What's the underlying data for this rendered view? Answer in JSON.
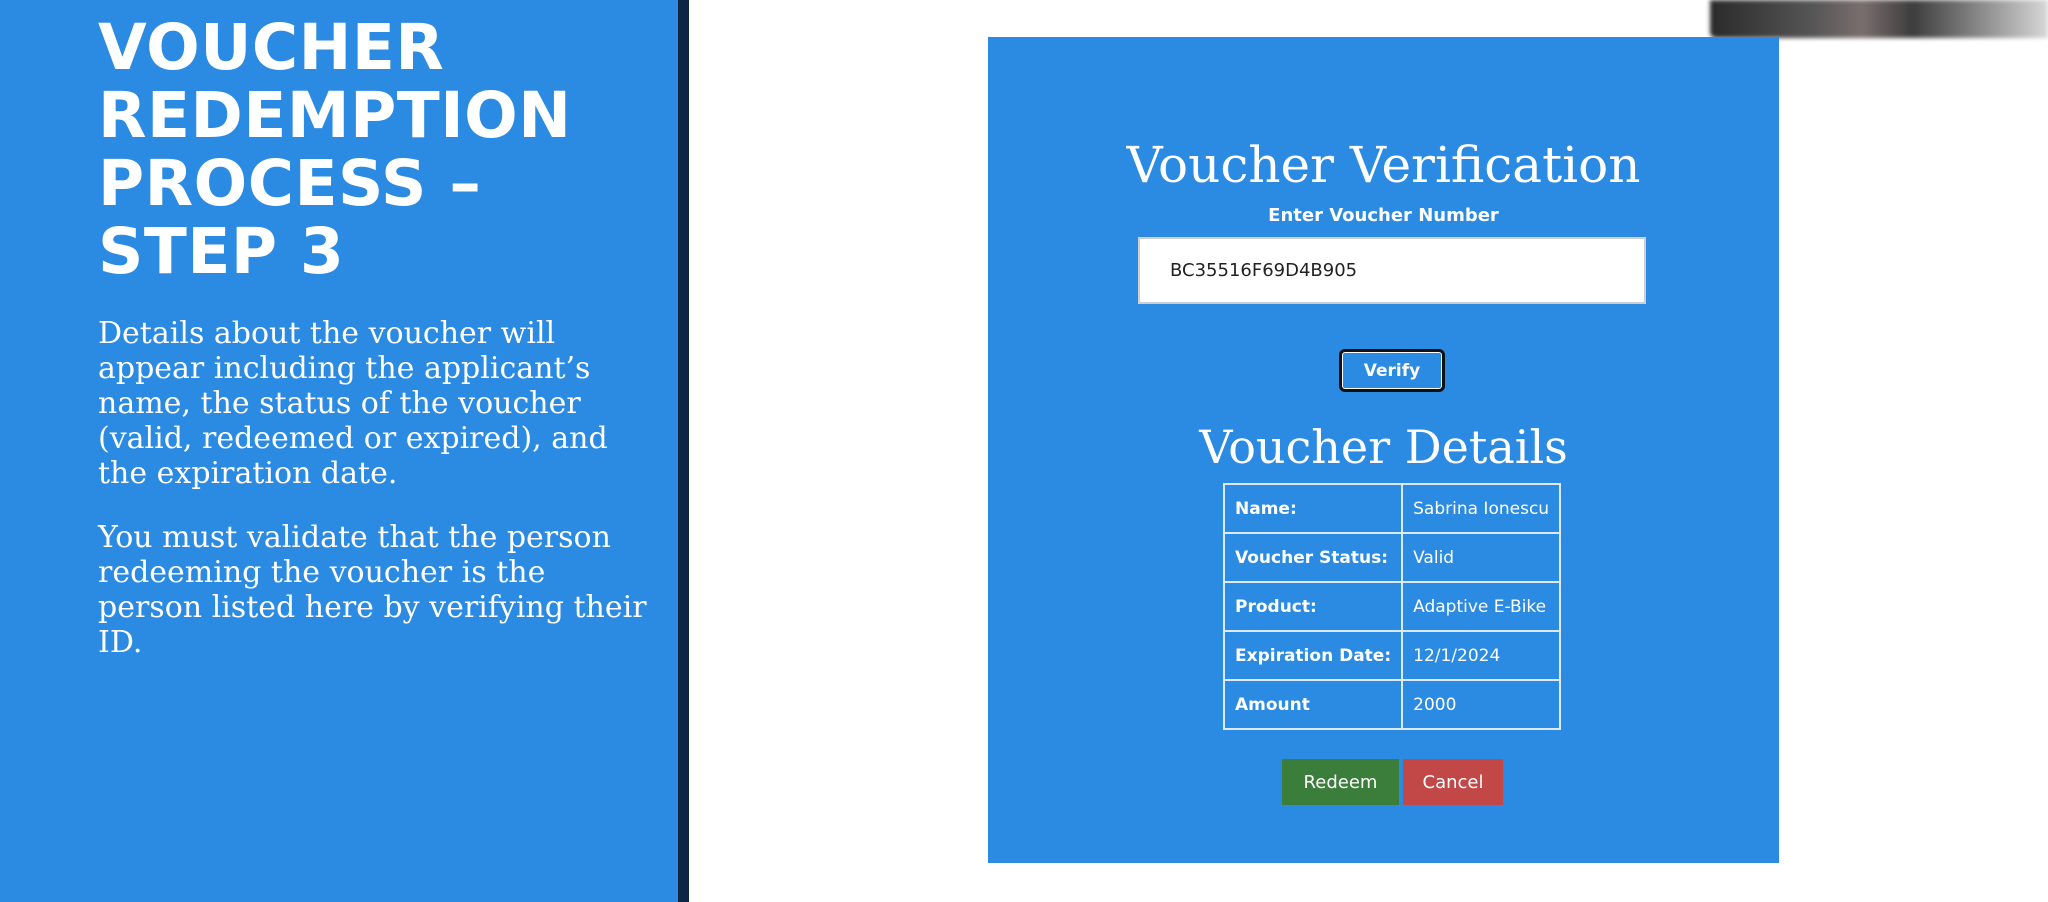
{
  "slide": {
    "title_lines": [
      "VOUCHER",
      "REDEMPTION",
      "PROCESS –",
      "STEP 3"
    ],
    "paragraphs": [
      "Details about the voucher will appear including the applicant’s name, the status of the voucher (valid, redeemed or expired), and the expiration date.",
      "You must validate that the person redeeming the voucher is the person listed here by verifying their ID."
    ]
  },
  "app": {
    "title": "Voucher Verification",
    "input_label": "Enter Voucher Number",
    "voucher_number": "BC35516F69D4B905",
    "verify_label": "Verify",
    "details_title": "Voucher Details",
    "details": [
      {
        "key": "Name:",
        "value": "Sabrina Ionescu"
      },
      {
        "key": "Voucher Status:",
        "value": "Valid"
      },
      {
        "key": "Product:",
        "value": "Adaptive E-Bike"
      },
      {
        "key": "Expiration Date:",
        "value": "12/1/2024"
      },
      {
        "key": "Amount",
        "value": "2000"
      }
    ],
    "redeem_label": "Redeem",
    "cancel_label": "Cancel"
  },
  "colors": {
    "panel_blue": "#2b8ae2",
    "divider_navy": "#0b2745",
    "redeem_green": "#3b7d3b",
    "cancel_red": "#c24848"
  }
}
